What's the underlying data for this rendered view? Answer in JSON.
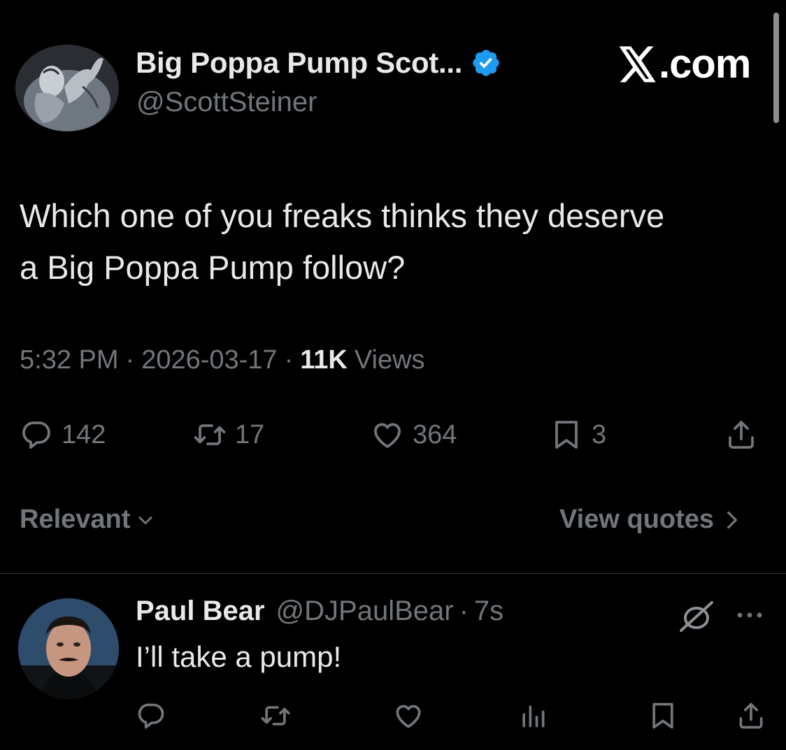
{
  "header": {
    "display_name": "Big Poppa Pump Scot...",
    "handle": "@ScottSteiner",
    "brand": ".com",
    "brand_icon": "x-logo-icon"
  },
  "tweet": {
    "text": "Which one of you freaks thinks they deserve\na Big Poppa Pump follow?",
    "time": "5:32 PM",
    "separator": "·",
    "date": "2026-03-17",
    "views_count": "11K",
    "views_label": "Views"
  },
  "actions": {
    "replies": "142",
    "reposts": "17",
    "likes": "364",
    "bookmarks": "3"
  },
  "sort": {
    "label": "Relevant",
    "view_quotes": "View quotes"
  },
  "reply": {
    "display_name": "Paul Bear",
    "handle": "@DJPaulBear",
    "separator": "·",
    "time": "7s",
    "text": "I’ll take a pump!"
  },
  "colors": {
    "background": "#000000",
    "primary_text": "#e7e9ea",
    "secondary_text": "#71767b",
    "verified": "#1d9bf0",
    "divider": "#2f3336"
  }
}
